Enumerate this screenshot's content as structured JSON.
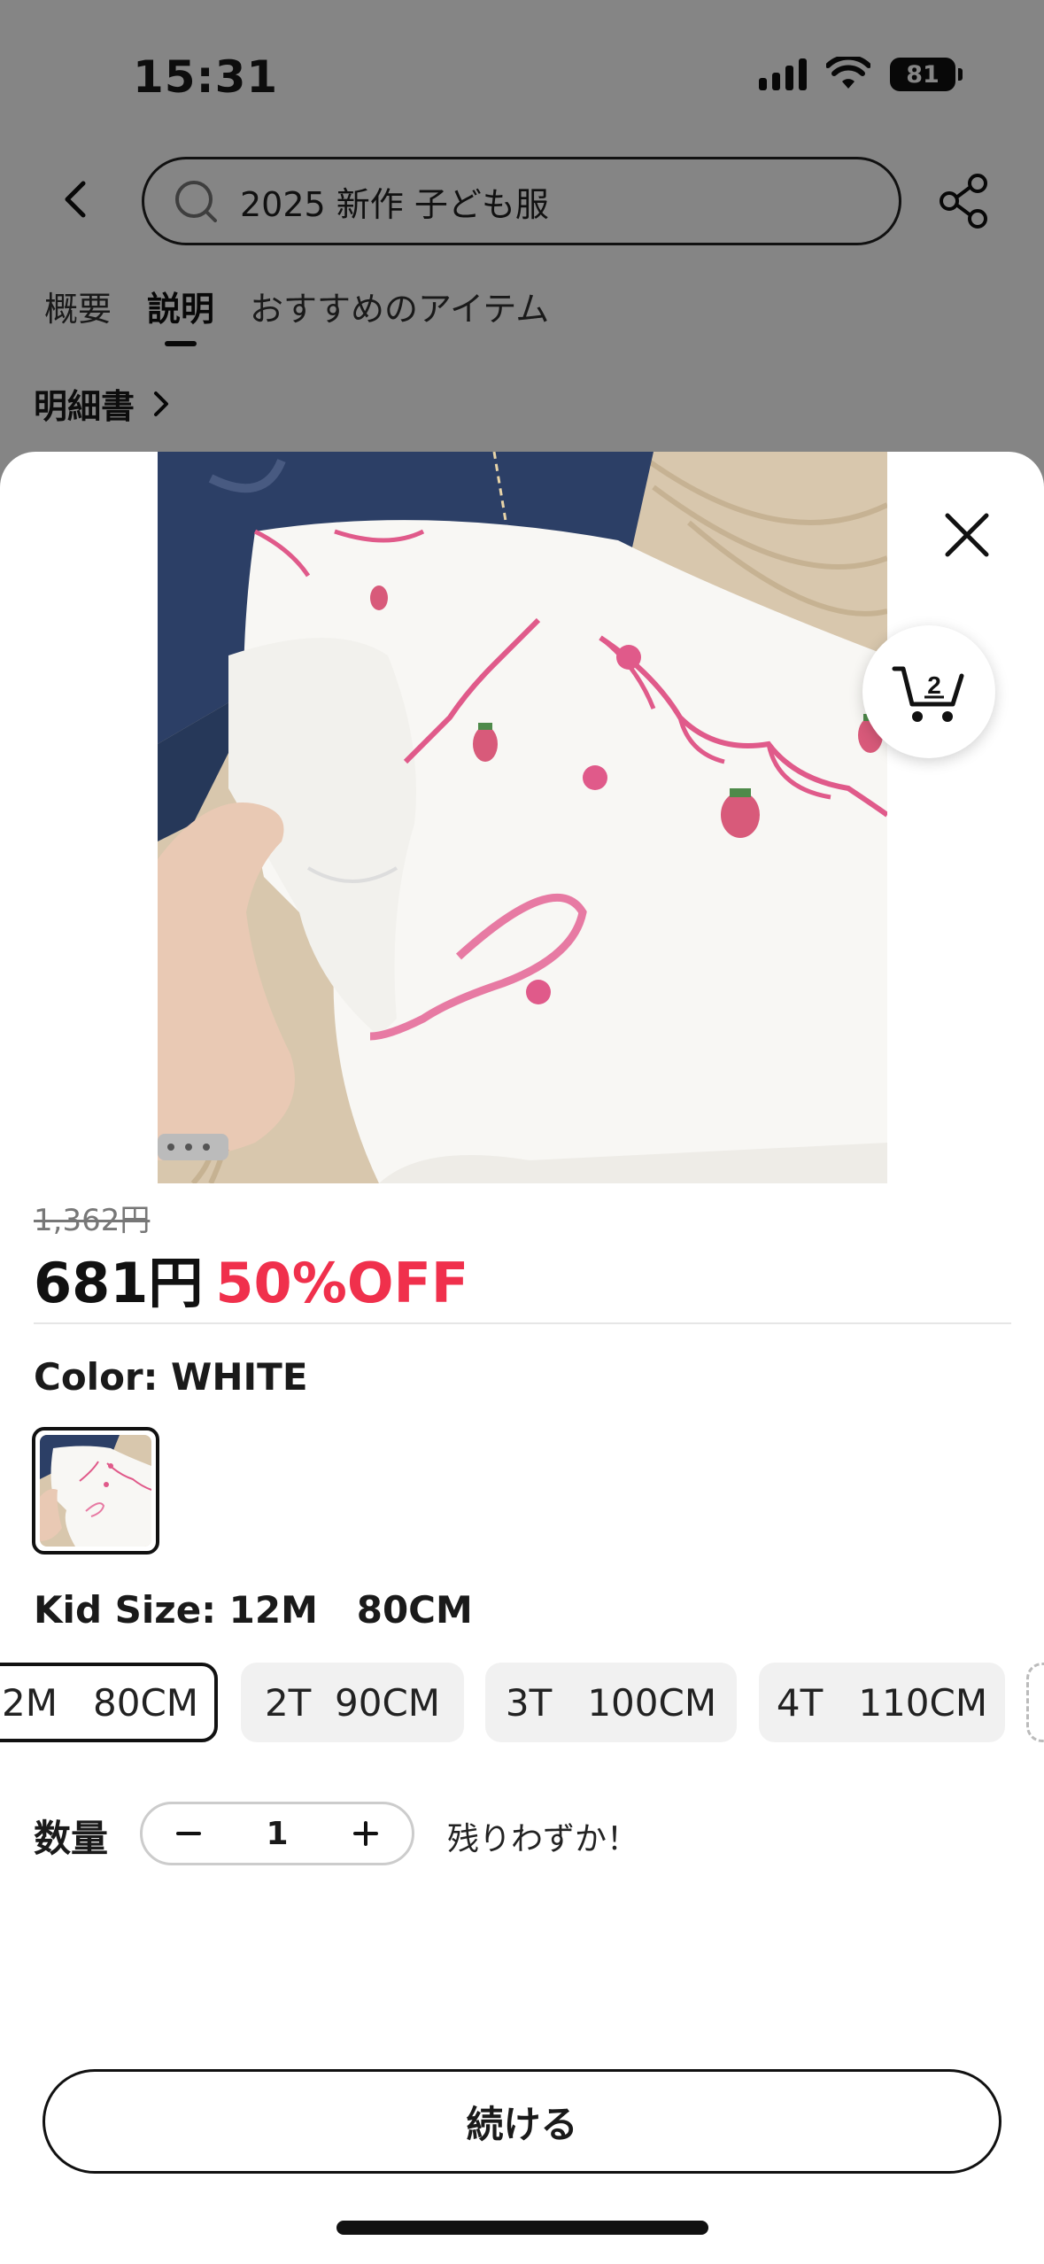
{
  "status_bar": {
    "time": "15:31",
    "battery": "81"
  },
  "header": {
    "search_query": "2025 新作 子ども服"
  },
  "tabs": [
    {
      "label": "概要",
      "active": false
    },
    {
      "label": "説明",
      "active": true
    },
    {
      "label": "おすすめのアイテム",
      "active": false
    }
  ],
  "spec_link": "明細書",
  "sheet": {
    "cart_count": "2",
    "original_price": "1,362円",
    "price": "681円",
    "discount": "50%OFF",
    "color_label": "Color: WHITE",
    "size_label": "Kid Size: 12M   80CM",
    "sizes": [
      {
        "label": "2M   80CM",
        "selected": true
      },
      {
        "label": "2T  90CM",
        "selected": false
      },
      {
        "label": "3T   100CM",
        "selected": false
      },
      {
        "label": "4T   110CM",
        "selected": false
      }
    ],
    "quantity_label": "数量",
    "quantity": "1",
    "stock_note": "残りわずか！",
    "continue_label": "続ける"
  },
  "colors": {
    "discount": "#f0304c",
    "embroidery": "#e05a8a"
  }
}
